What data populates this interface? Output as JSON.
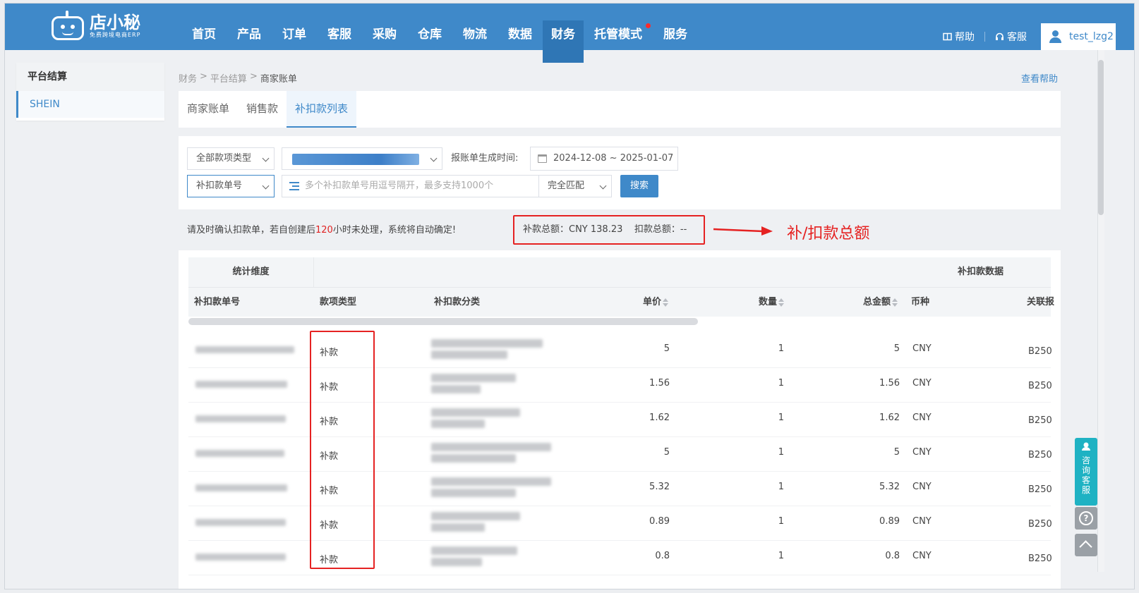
{
  "logo": {
    "name": "店小秘",
    "sub": "免费跨境电商ERP"
  },
  "nav": {
    "items": [
      "首页",
      "产品",
      "订单",
      "客服",
      "采购",
      "仓库",
      "物流",
      "数据",
      "财务",
      "托管模式",
      "服务"
    ],
    "help": "帮助",
    "service": "客服",
    "user": "test_lzg2"
  },
  "sidebar": {
    "header": "平台结算",
    "items": [
      "SHEIN"
    ]
  },
  "breadcrumb": [
    "财务",
    "平台结算",
    "商家账单"
  ],
  "help_link": "查看帮助",
  "tabs": [
    "商家账单",
    "销售款",
    "补扣款列表"
  ],
  "filters": {
    "type_select": "全部款项类型",
    "date_label": "报账单生成时间:",
    "date_range": "2024-12-08 ~ 2025-01-07",
    "field_select": "补扣款单号",
    "input_placeholder": "多个补扣款单号用逗号隔开，最多支持1000个",
    "match_select": "完全匹配",
    "search_button": "搜索"
  },
  "notice": {
    "pre": "请及时确认扣款单，若自创建后",
    "hours": "120",
    "post": "小时未处理，系统将自动确定!"
  },
  "totals": {
    "text": "补款总额：CNY 138.23    扣款总额：--"
  },
  "annotation": "补/扣款总额",
  "table": {
    "group_headers": [
      "统计维度",
      "补扣款数据"
    ],
    "headers": [
      "补扣款单号",
      "款项类型",
      "补扣款分类",
      "单价",
      "数量",
      "总金额",
      "币种",
      "关联报"
    ],
    "rows": [
      {
        "type": "补款",
        "price": "5",
        "qty": "1",
        "total": "5",
        "currency": "CNY",
        "ref": "B250"
      },
      {
        "type": "补款",
        "price": "1.56",
        "qty": "1",
        "total": "1.56",
        "currency": "CNY",
        "ref": "B250"
      },
      {
        "type": "补款",
        "price": "1.62",
        "qty": "1",
        "total": "1.62",
        "currency": "CNY",
        "ref": "B250"
      },
      {
        "type": "补款",
        "price": "5",
        "qty": "1",
        "total": "5",
        "currency": "CNY",
        "ref": "B250"
      },
      {
        "type": "补款",
        "price": "5.32",
        "qty": "1",
        "total": "5.32",
        "currency": "CNY",
        "ref": "B250"
      },
      {
        "type": "补款",
        "price": "0.89",
        "qty": "1",
        "total": "0.89",
        "currency": "CNY",
        "ref": "B250"
      },
      {
        "type": "补款",
        "price": "0.8",
        "qty": "1",
        "total": "0.8",
        "currency": "CNY",
        "ref": "B250"
      }
    ]
  },
  "float": {
    "cs_label": "咨询客服"
  },
  "colors": {
    "primary": "#3f89c9",
    "annotation": "#e52222",
    "cs": "#1fb2c3"
  }
}
